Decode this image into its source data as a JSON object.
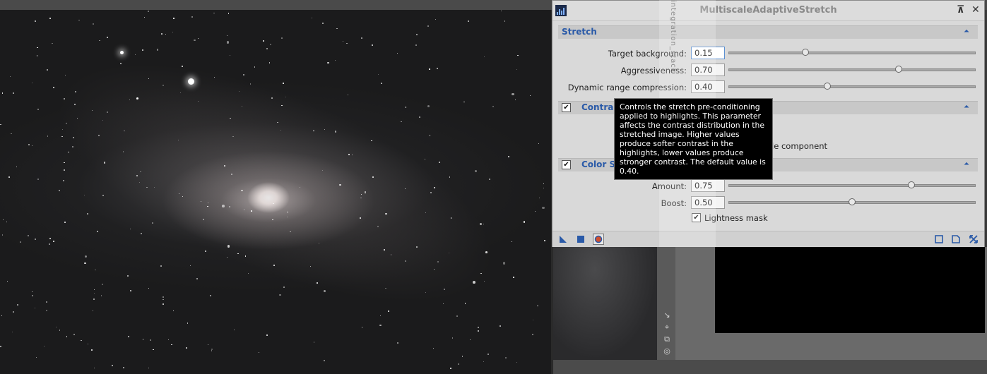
{
  "window": {
    "title": "MultiscaleAdaptiveStretch",
    "pin_icon": "pin-icon",
    "close_icon": "close-icon"
  },
  "overlay_text": "integration_stack",
  "stretch": {
    "title": "Stretch",
    "params": [
      {
        "label": "Target background:",
        "value": "0.15",
        "fraction": 0.31
      },
      {
        "label": "Aggressiveness:",
        "value": "0.70",
        "fraction": 0.69
      },
      {
        "label": "Dynamic range compression:",
        "value": "0.40",
        "fraction": 0.4
      }
    ]
  },
  "contrast": {
    "title": "Contrast",
    "checked": true,
    "note": "ale component"
  },
  "color_saturation": {
    "title": "Color Sa",
    "checked": true,
    "params": [
      {
        "label": "Amount:",
        "value": "0.75",
        "fraction": 0.74
      },
      {
        "label": "Boost:",
        "value": "0.50",
        "fraction": 0.5
      }
    ],
    "lightness_mask": {
      "label": "Lightness mask",
      "checked": true
    }
  },
  "tooltip": {
    "text": "Controls the stretch pre-conditioning applied to highlights. This parameter affects the contrast distribution in the stretched image. Higher values produce softer contrast in the highlights, lower values produce stronger contrast. The default value is 0.40."
  },
  "toolbar": {
    "left": [
      "new-instance-icon",
      "apply-global-icon",
      "real-time-preview-icon"
    ],
    "right": [
      "browse-documentation-icon",
      "save-icon",
      "reset-icon"
    ]
  },
  "colors": {
    "accent": "#2a5aa8",
    "window_bg": "#d9d9d9",
    "tooltip_bg": "#000000"
  }
}
